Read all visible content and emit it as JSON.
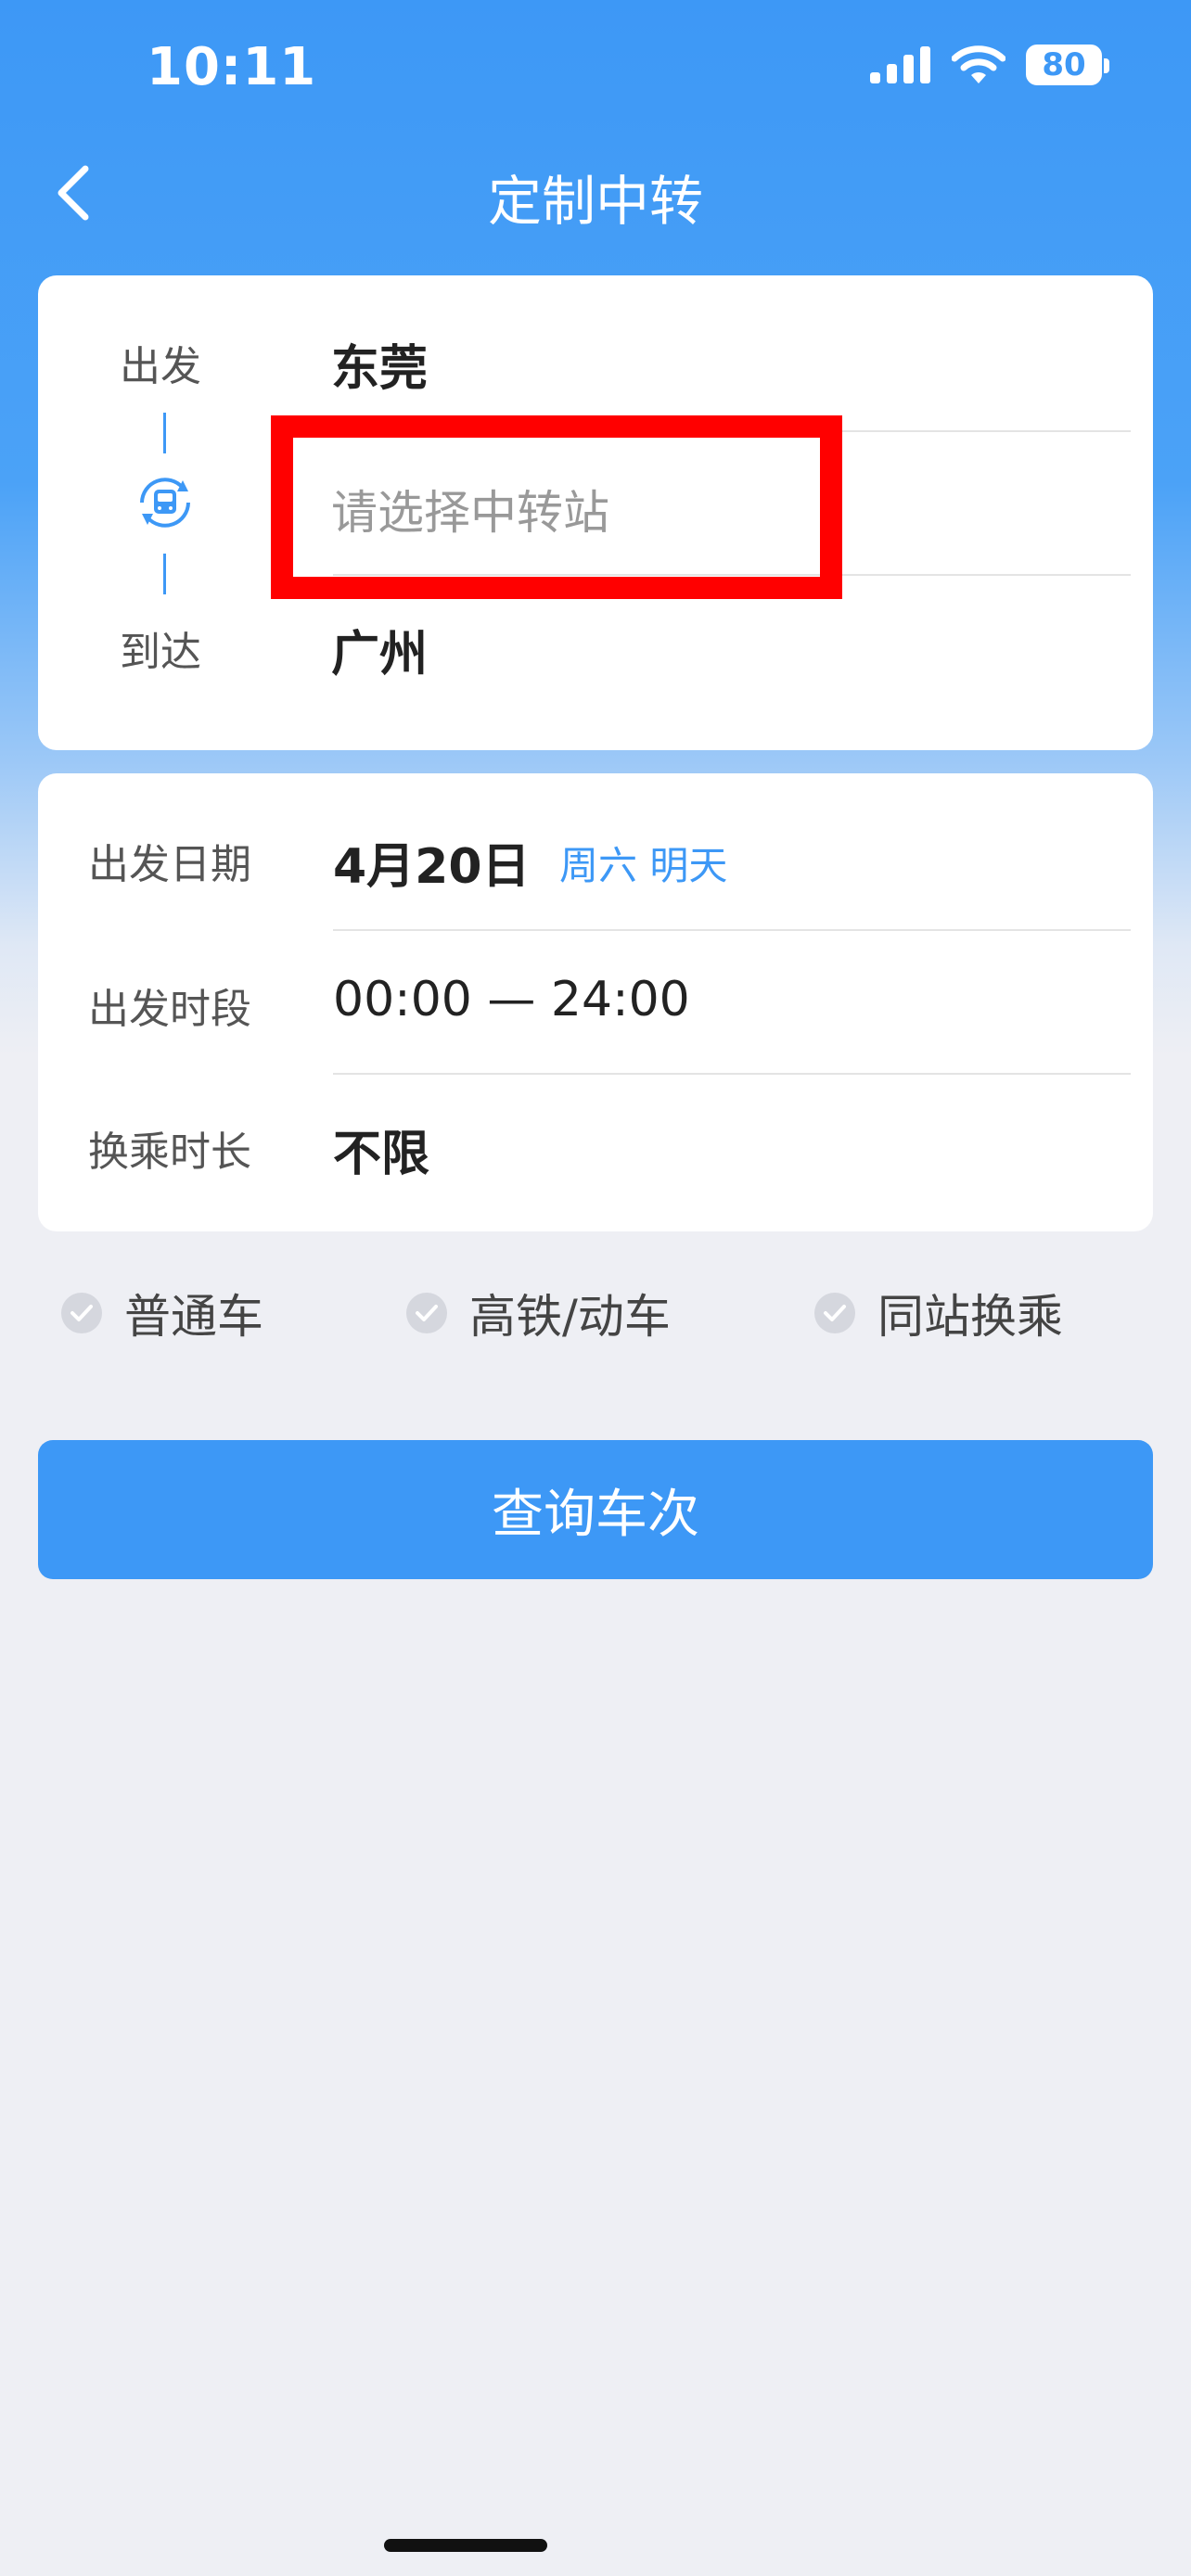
{
  "status_bar": {
    "time": "10:11",
    "battery": "80"
  },
  "navbar": {
    "title": "定制中转"
  },
  "route": {
    "depart_label": "出发",
    "depart_value": "东莞",
    "transfer_placeholder": "请选择中转站",
    "arrive_label": "到达",
    "arrive_value": "广州"
  },
  "options_card": {
    "date_label": "出发日期",
    "date_value": "4月20日",
    "date_note": "周六 明天",
    "time_label": "出发时段",
    "time_value": "00:00 — 24:00",
    "duration_label": "换乘时长",
    "duration_value": "不限"
  },
  "filters": [
    "普通车",
    "高铁/动车",
    "同站换乘"
  ],
  "query_button": "查询车次",
  "colors": {
    "primary": "#3d98f6",
    "highlight": "#ff0000",
    "background": "#eeeff4"
  }
}
